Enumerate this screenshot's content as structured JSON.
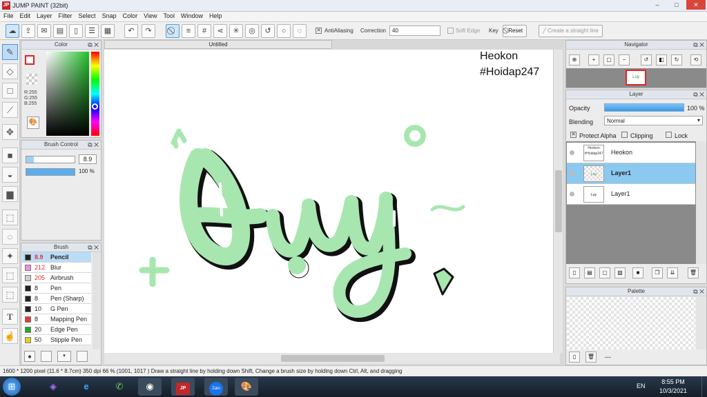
{
  "app": {
    "title": "JUMP PAINT (32bit)",
    "logo": "JP"
  },
  "window_controls": {
    "minimize": "–",
    "maximize": "□",
    "close": "✕"
  },
  "menu": [
    "File",
    "Edit",
    "Layer",
    "Filter",
    "Select",
    "Snap",
    "Color",
    "View",
    "Tool",
    "Window",
    "Help"
  ],
  "toolbar": {
    "antialiasing_label": "AntiAliasing",
    "correction_label": "Correction",
    "correction_value": "40",
    "soft_edge_label": "Soft Edge",
    "key_label": "Key",
    "reset_label": "Reset",
    "straight_line_label": "Create a straight line"
  },
  "color_panel": {
    "title": "Color",
    "rgb": [
      "R:255",
      "G:255",
      "B:255"
    ]
  },
  "brush_control": {
    "title": "Brush Control",
    "size_value": "8.9",
    "opacity_value": "100 %"
  },
  "brush_panel": {
    "title": "Brush",
    "items": [
      {
        "size": "8.9",
        "name": "Pencil",
        "color": "#222222"
      },
      {
        "size": "212",
        "name": "Blur",
        "color": "#f08fe0"
      },
      {
        "size": "205",
        "name": "Airbrush",
        "color": "#cccccc"
      },
      {
        "size": "8",
        "name": "Pen",
        "color": "#222222"
      },
      {
        "size": "8",
        "name": "Pen (Sharp)",
        "color": "#222222"
      },
      {
        "size": "10",
        "name": "G Pen",
        "color": "#222222"
      },
      {
        "size": "8",
        "name": "Mapping Pen",
        "color": "#e53935"
      },
      {
        "size": "20",
        "name": "Edge Pen",
        "color": "#22aa22"
      },
      {
        "size": "50",
        "name": "Stipple Pen",
        "color": "#e5d21f"
      }
    ]
  },
  "canvas": {
    "tab_title": "Untitled",
    "watermark_line1": "Heokon",
    "watermark_line2": "#Hoidap247",
    "art_fill": "#a8e6b0",
    "art_outline": "#111111"
  },
  "navigator": {
    "title": "Navigator"
  },
  "layer_panel": {
    "title": "Layer",
    "opacity_label": "Opacity",
    "opacity_value": "100 %",
    "blending_label": "Blending",
    "blending_value": "Normal",
    "protect_alpha_label": "Protect Alpha",
    "clipping_label": "Clipping",
    "lock_label": "Lock",
    "layers": [
      {
        "name": "Heokon",
        "thumb": "Heokon #Hoidap247"
      },
      {
        "name": "Layer1",
        "thumb": "Luy"
      },
      {
        "name": "Layer1",
        "thumb": "Luy"
      }
    ]
  },
  "palette_panel": {
    "title": "Palette",
    "footer_text": "---"
  },
  "status": {
    "size": "1600 * 1200 pixel",
    "physical": "(11.6 * 8.7cm)",
    "dpi": "350 dpi",
    "zoom": "66 %",
    "coords": "(1001, 1017 )",
    "hint": "Draw a straight line by holding down Shift, Change a brush size by holding down Ctrl, Alt, and dragging"
  },
  "taskbar": {
    "language": "EN",
    "time": "8:55 PM",
    "date": "10/3/2021",
    "apps": [
      "start-orb",
      "visual-studio",
      "internet-explorer",
      "whatsapp",
      "chrome",
      "jump-paint",
      "zalo",
      "paint"
    ]
  }
}
